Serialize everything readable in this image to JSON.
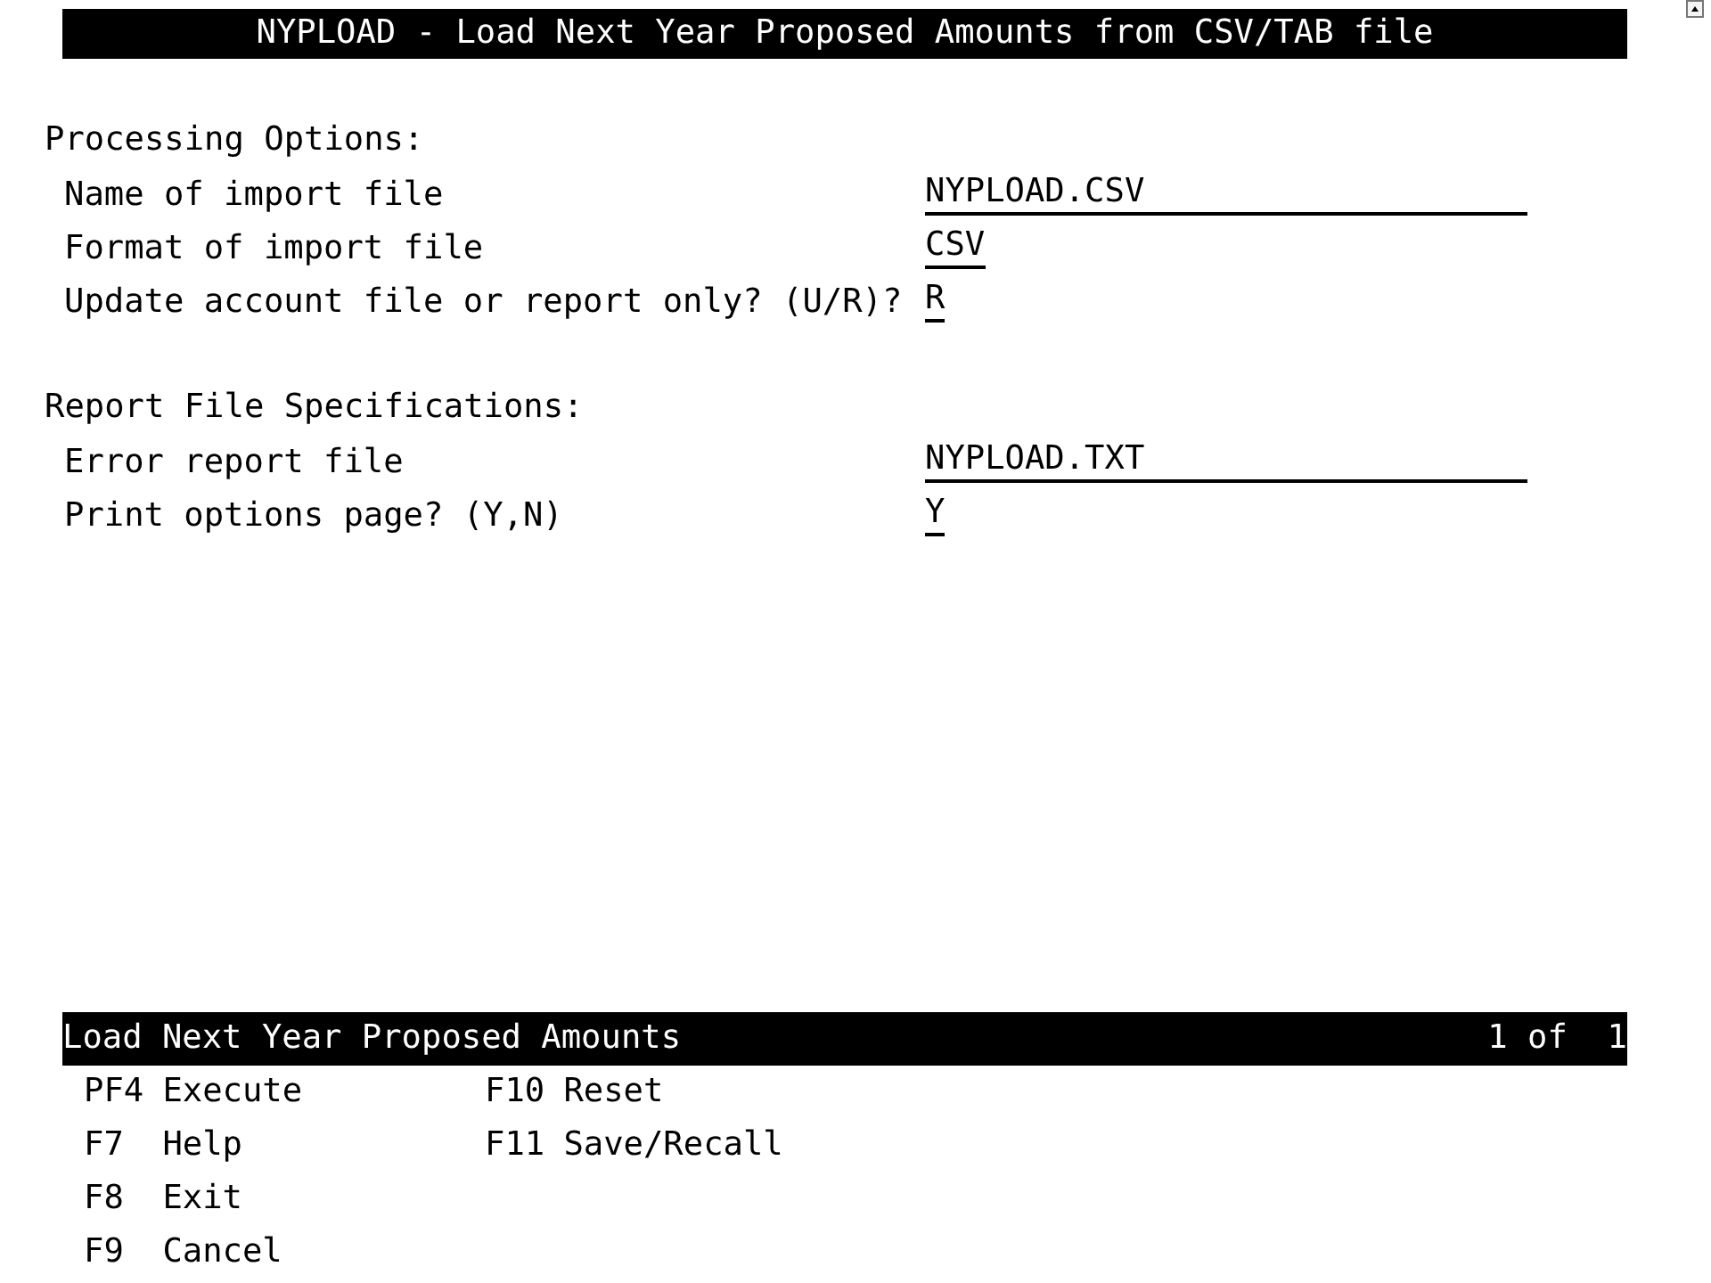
{
  "window": {
    "title": "NYPLOAD - Load Next Year Proposed Amounts from CSV/TAB file"
  },
  "sections": [
    {
      "heading": "Processing Options:",
      "fields": [
        {
          "label": "Name of import file",
          "value": "NYPLOAD.CSV",
          "kind": "text"
        },
        {
          "label": "Format of import file",
          "value": "CSV",
          "kind": "code"
        },
        {
          "label": "Update account file or report only? (U/R)?",
          "value": "R",
          "kind": "code"
        }
      ]
    },
    {
      "heading": "Report File Specifications:",
      "fields": [
        {
          "label": "Error report file",
          "value": "NYPLOAD.TXT",
          "kind": "text"
        },
        {
          "label": "Print options page? (Y,N)",
          "value": "Y",
          "kind": "code"
        }
      ]
    }
  ],
  "status_bar": {
    "title": "Load Next Year Proposed Amounts",
    "page": "1 of  1"
  },
  "function_keys": {
    "columns": [
      {
        "keys": [
          {
            "key": "PF4",
            "action": "Execute"
          },
          {
            "key": "F7",
            "action": "Help"
          },
          {
            "key": "F8",
            "action": "Exit"
          },
          {
            "key": "F9",
            "action": "Cancel"
          }
        ]
      },
      {
        "keys": [
          {
            "key": "F10",
            "action": "Reset"
          },
          {
            "key": "F11",
            "action": "Save/Recall"
          }
        ]
      }
    ]
  }
}
